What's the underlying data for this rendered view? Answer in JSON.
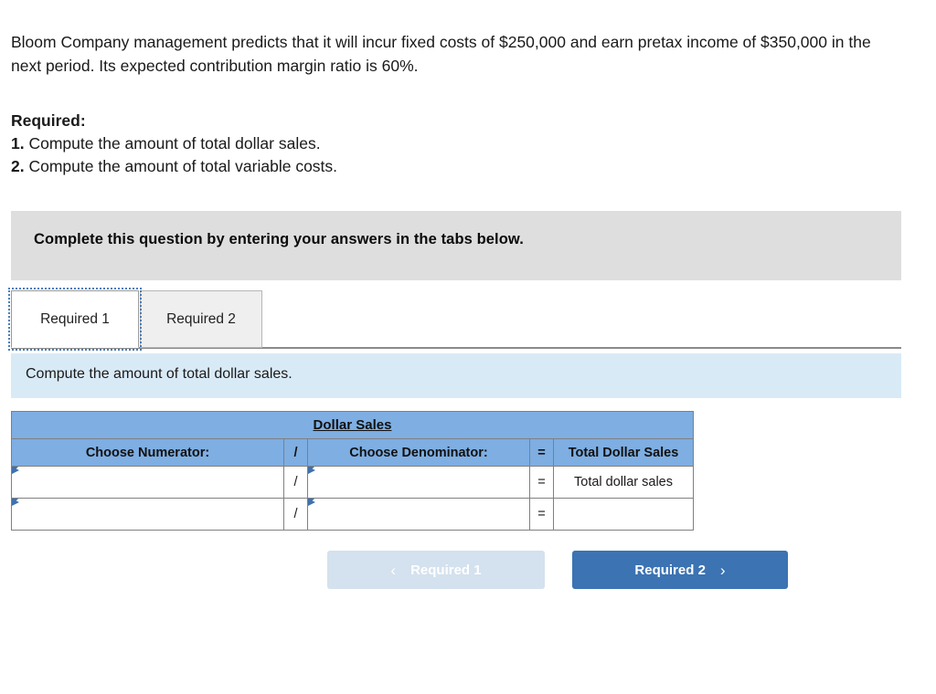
{
  "problem": {
    "statement": "Bloom Company management predicts that it will incur fixed costs of $250,000 and earn pretax income of $350,000 in the next period. Its expected contribution margin ratio is 60%."
  },
  "required": {
    "heading": "Required:",
    "items": [
      {
        "number": "1.",
        "text": "Compute the amount of total dollar sales."
      },
      {
        "number": "2.",
        "text": "Compute the amount of total variable costs."
      }
    ]
  },
  "banner": {
    "text": "Complete this question by entering your answers in the tabs below."
  },
  "tabs": [
    {
      "label": "Required 1",
      "active": true
    },
    {
      "label": "Required 2",
      "active": false
    }
  ],
  "subinstruction": {
    "text": "Compute the amount of total dollar sales."
  },
  "table": {
    "title": "Dollar Sales",
    "headers": [
      "Choose Numerator:",
      "/",
      "Choose Denominator:",
      "=",
      "Total Dollar Sales"
    ],
    "rows": [
      {
        "numerator": "",
        "operator": "/",
        "denominator": "",
        "equals": "=",
        "total": "Total dollar sales"
      },
      {
        "numerator": "",
        "operator": "/",
        "denominator": "",
        "equals": "=",
        "total": ""
      }
    ]
  },
  "nav": {
    "prev": {
      "label": "Required 1",
      "chevron": "‹",
      "disabled": true
    },
    "next": {
      "label": "Required 2",
      "chevron": "›",
      "disabled": false
    }
  },
  "colors": {
    "banner_gray": "#dedede",
    "subinstruction_blue": "#d9eaf7",
    "table_header_blue": "#7eaee2",
    "button_active_blue": "#3b73b3",
    "button_disabled_blue": "#d4e1ee",
    "marker_blue": "#3e72b0"
  }
}
